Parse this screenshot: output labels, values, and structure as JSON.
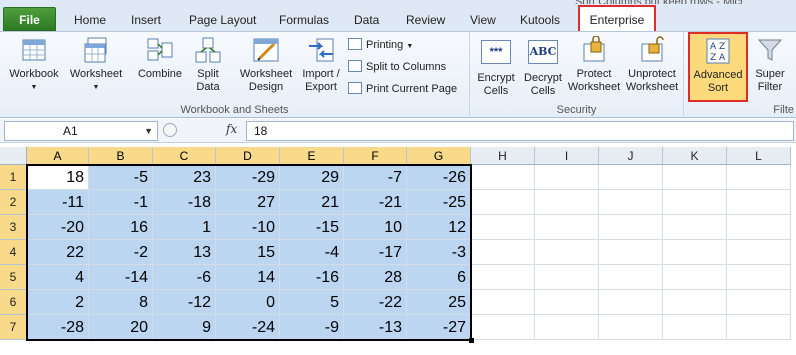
{
  "window": {
    "title_fragment": "Sort Columns but keep rows - Micr"
  },
  "tabs": [
    {
      "id": "file",
      "label": "File"
    },
    {
      "id": "home",
      "label": "Home"
    },
    {
      "id": "insert",
      "label": "Insert"
    },
    {
      "id": "page_layout",
      "label": "Page Layout"
    },
    {
      "id": "formulas",
      "label": "Formulas"
    },
    {
      "id": "data",
      "label": "Data"
    },
    {
      "id": "review",
      "label": "Review"
    },
    {
      "id": "view",
      "label": "View"
    },
    {
      "id": "kutools",
      "label": "Kutools"
    },
    {
      "id": "enterprise",
      "label": "Enterprise"
    }
  ],
  "ribbon": {
    "workbook_sheets": {
      "label": "Workbook and Sheets",
      "workbook": "Workbook",
      "worksheet": "Worksheet",
      "combine": "Combine",
      "split_data": [
        "Split",
        "Data"
      ],
      "worksheet_design": [
        "Worksheet",
        "Design"
      ],
      "import_export": [
        "Import /",
        "Export"
      ],
      "printing": "Printing",
      "split_to_columns": "Split to Columns",
      "print_current_page": "Print Current Page"
    },
    "security": {
      "label": "Security",
      "encrypt": [
        "Encrypt",
        "Cells"
      ],
      "decrypt": [
        "Decrypt",
        "Cells"
      ],
      "protect": [
        "Protect",
        "Worksheet"
      ],
      "unprotect": [
        "Unprotect",
        "Worksheet"
      ]
    },
    "filter": {
      "label": "Filte",
      "advanced_sort": [
        "Advanced",
        "Sort"
      ],
      "super_filter": [
        "Super",
        "Filter"
      ]
    },
    "icon_text": {
      "encrypt": "***",
      "decrypt": "ABC"
    }
  },
  "formula_bar": {
    "name_box": "A1",
    "fx": "fx",
    "value": "18"
  },
  "sheet": {
    "columns": [
      "A",
      "B",
      "C",
      "D",
      "E",
      "F",
      "G",
      "H",
      "I",
      "J",
      "K",
      "L"
    ],
    "rows": [
      "1",
      "2",
      "3",
      "4",
      "5",
      "6",
      "7"
    ],
    "data": [
      [
        18,
        -5,
        23,
        -29,
        29,
        -7,
        -26
      ],
      [
        -11,
        -1,
        -18,
        27,
        21,
        -21,
        -25
      ],
      [
        -20,
        16,
        1,
        -10,
        -15,
        10,
        12
      ],
      [
        22,
        -2,
        13,
        15,
        -4,
        -17,
        -3
      ],
      [
        4,
        -14,
        -6,
        14,
        -16,
        28,
        6
      ],
      [
        2,
        8,
        -12,
        0,
        5,
        -22,
        25
      ],
      [
        -28,
        20,
        9,
        -24,
        -9,
        -13,
        -27
      ]
    ],
    "selection": "A1:G7",
    "active_cell": "A1"
  },
  "colors": {
    "selection_fill": "#bcd6f2",
    "highlight_outline": "#e02b2b",
    "file_tab": "#2d7a24",
    "selected_header": "#f9d98a"
  }
}
